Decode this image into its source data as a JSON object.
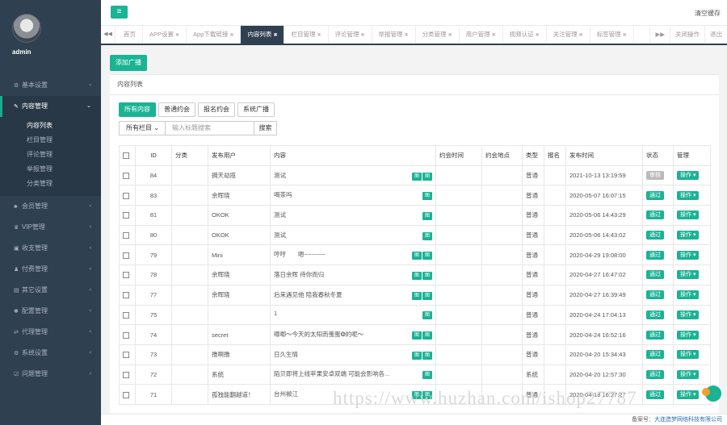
{
  "user": {
    "name": "admin"
  },
  "sidebar": {
    "items": [
      {
        "icon": "⚙",
        "label": "基本设置",
        "arrow": "‹"
      },
      {
        "icon": "✎",
        "label": "内容管理",
        "arrow": "⌄",
        "active": true,
        "sub": [
          "内容列表",
          "栏目管理",
          "评论管理",
          "举报管理",
          "分类管理"
        ]
      },
      {
        "icon": "♣",
        "label": "会员管理",
        "arrow": "‹"
      },
      {
        "icon": "♛",
        "label": "VIP管理",
        "arrow": "‹"
      },
      {
        "icon": "▣",
        "label": "收支管理",
        "arrow": "‹"
      },
      {
        "icon": "♟",
        "label": "付费管理",
        "arrow": "‹"
      },
      {
        "icon": "▤",
        "label": "其它设置",
        "arrow": "‹"
      },
      {
        "icon": "✱",
        "label": "配置管理",
        "arrow": "‹"
      },
      {
        "icon": "⇄",
        "label": "代理管理",
        "arrow": "‹"
      },
      {
        "icon": "⚙",
        "label": "系统设置",
        "arrow": "‹"
      },
      {
        "icon": "☑",
        "label": "问题管理",
        "arrow": "‹"
      }
    ]
  },
  "topbar": {
    "clear_cache": "清空缓存"
  },
  "tabs": [
    "首页",
    "APP设置",
    "App下载链接",
    "内容列表",
    "栏目管理",
    "评论管理",
    "举报管理",
    "分类管理",
    "用户管理",
    "视频认证",
    "关注管理",
    "标签管理"
  ],
  "tab_right": [
    "关闭操作",
    "退出"
  ],
  "add_button": "添加广播",
  "panel_title": "内容列表",
  "filter_tabs": [
    "所有内容",
    "普通约会",
    "报名约会",
    "系统广播"
  ],
  "search": {
    "select": "所有栏目",
    "placeholder": "输入标题搜索",
    "button": "搜索"
  },
  "table": {
    "headers": [
      "",
      "ID",
      "分类",
      "发布用户",
      "内容",
      "约会时间",
      "约会地点",
      "类型",
      "报名",
      "发布时间",
      "状态",
      "管理"
    ],
    "rows": [
      {
        "id": "84",
        "user": "拥天劫揽",
        "content": "测试",
        "tags": [
          "图",
          "图"
        ],
        "type": "普通",
        "time": "2021-10-13 13:19:59",
        "status": "审核",
        "status_grey": true,
        "op": "操作"
      },
      {
        "id": "83",
        "user": "余晖晓",
        "content": "喝茶吗",
        "tags": [
          "图"
        ],
        "type": "普通",
        "time": "2020-05-07 16:07:15",
        "status": "通过",
        "op": "操作"
      },
      {
        "id": "81",
        "user": "OKOK",
        "content": "测试",
        "tags": [
          "图"
        ],
        "type": "普通",
        "time": "2020-05-06 14:43:29",
        "status": "通过",
        "op": "操作"
      },
      {
        "id": "80",
        "user": "OKOK",
        "content": "测试",
        "tags": [
          "图"
        ],
        "type": "普通",
        "time": "2020-05-06 14:43:02",
        "status": "通过",
        "op": "操作"
      },
      {
        "id": "79",
        "user": "Mini",
        "content": "哼哼　　嗯~~~~~~",
        "tags": [
          "图",
          "图"
        ],
        "type": "普通",
        "time": "2020-04-29 19:08:00",
        "status": "通过",
        "op": "操作"
      },
      {
        "id": "78",
        "user": "余晖晓",
        "content": "落日余晖 待你而归",
        "tags": [
          "图",
          "图"
        ],
        "type": "普通",
        "time": "2020-04-27 16:47:02",
        "status": "通过",
        "op": "操作"
      },
      {
        "id": "77",
        "user": "余晖晓",
        "content": "后来遇见他 陪我春秋冬夏",
        "tags": [
          "图",
          "图"
        ],
        "type": "普通",
        "time": "2020-04-27 16:39:49",
        "status": "通过",
        "op": "操作"
      },
      {
        "id": "75",
        "user": "",
        "content": "1",
        "tags": [
          "图"
        ],
        "type": "普通",
        "time": "2020-04-24 17:04:13",
        "status": "通过",
        "op": "操作"
      },
      {
        "id": "74",
        "user": "secret",
        "content": "唧唧～今天的太阳而蛋蛋❂的呢～",
        "tags": [
          "图",
          "图"
        ],
        "type": "普通",
        "time": "2020-04-24 16:52:16",
        "status": "通过",
        "op": "操作"
      },
      {
        "id": "73",
        "user": "撸啊撸",
        "content": "日久生情",
        "tags": [
          "图",
          "图"
        ],
        "type": "普通",
        "time": "2020-04-20 15:34:43",
        "status": "通过",
        "op": "操作"
      },
      {
        "id": "72",
        "user": "系统",
        "content": "陌贝即将上线苹果安卓双端 可能会影响各...",
        "tags": [
          "图"
        ],
        "type": "系统",
        "time": "2020-04-20 12:57:30",
        "status": "通过",
        "op": "操作"
      },
      {
        "id": "71",
        "user": "孤独能翻越道！",
        "content": "台州椒江",
        "tags": [
          "图",
          "图"
        ],
        "type": "普通",
        "time": "2020-04-18 16:27:27",
        "status": "通过",
        "op": "操作"
      }
    ]
  },
  "watermark": "https://www.huzhan.com/ishop27787",
  "footer": {
    "label": "备案号：",
    "value": "大连造梦网络科技有限公司"
  }
}
